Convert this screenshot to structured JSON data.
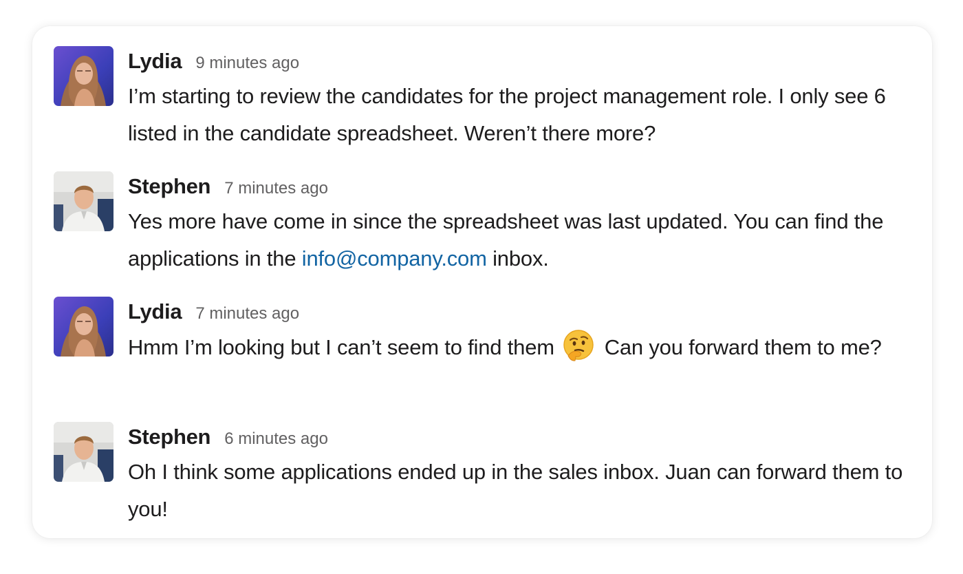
{
  "messages": [
    {
      "author": "Lydia",
      "timestamp": "9 minutes ago",
      "avatar_icon": "avatar-lydia",
      "text": "I’m starting to review the candidates for the project management role. I only see 6 listed in the candidate spreadsheet. Weren’t there more?"
    },
    {
      "author": "Stephen",
      "timestamp": "7 minutes ago",
      "avatar_icon": "avatar-stephen",
      "text_before_link": "Yes more have come in since the spreadsheet was last updated. You can find the applications in the ",
      "link": "info@company.com",
      "text_after_link": " inbox."
    },
    {
      "author": "Lydia",
      "timestamp": "7 minutes ago",
      "avatar_icon": "avatar-lydia",
      "text_before_emoji": "Hmm I’m looking but I can’t seem to find them ",
      "emoji": "thinking-face-emoji",
      "text_after_emoji": " Can you forward them to me?"
    },
    {
      "author": "Stephen",
      "timestamp": "6 minutes ago",
      "avatar_icon": "avatar-stephen",
      "text": "Oh I think some applications ended up in the sales inbox. Juan can forward them to you!"
    }
  ],
  "colors": {
    "text": "#1d1c1d",
    "timestamp": "#616061",
    "link": "#1264a3"
  }
}
